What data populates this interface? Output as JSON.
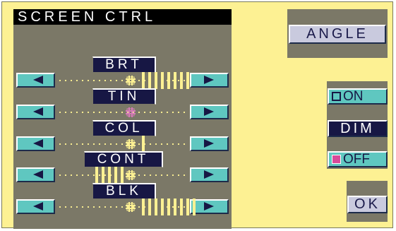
{
  "title": "SCREEN CTRL",
  "controls": [
    {
      "label": "BRT",
      "level": 0.85,
      "marker_color": "#fdf193"
    },
    {
      "label": "TIN",
      "level": 0.0,
      "marker_color": "#d67ab8"
    },
    {
      "label": "COL",
      "level": 0.15,
      "marker_color": "#fdf193"
    },
    {
      "label": "CONT",
      "level": -0.6,
      "marker_color": "#fdf193"
    },
    {
      "label": "BLK",
      "level": 1.0,
      "marker_color": "#fdf193"
    }
  ],
  "angle_label": "ANGLE",
  "on_label": "ON",
  "dim_label": "DIM",
  "off_label": "OFF",
  "ok_label": "OK",
  "icons": {
    "left": "left-triangle-icon",
    "right": "right-triangle-icon"
  },
  "colors": {
    "panel": "#7b7867",
    "background": "#fdf193",
    "label_bg": "#171744",
    "button_teal": "#5fc7c0",
    "off_indicator": "#d84a9a"
  }
}
